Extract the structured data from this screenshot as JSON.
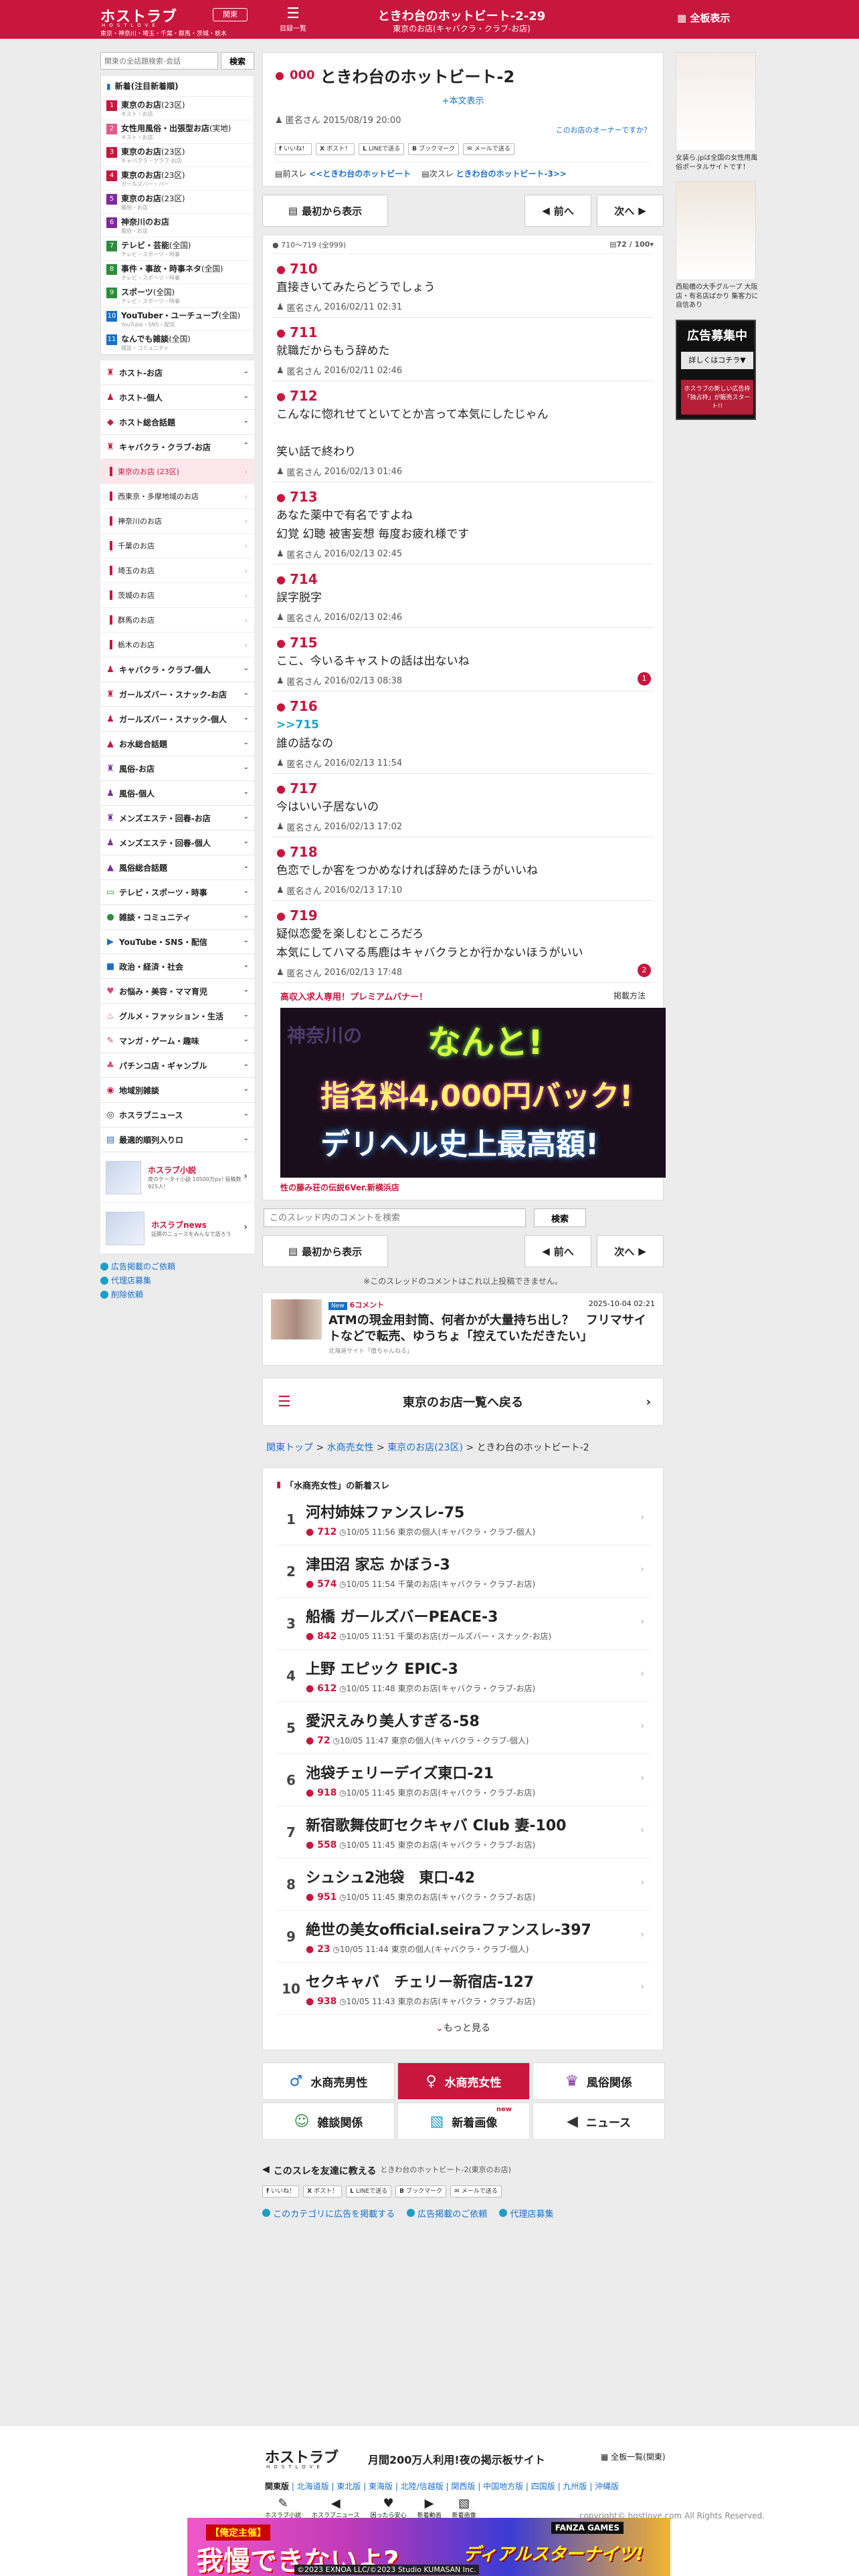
{
  "header": {
    "logo": "ホストラブ",
    "logo_sub": "HOSTLOVE",
    "region": "東京・神奈川・埼玉・千葉・群馬・茨城・栃木",
    "area_button": "関東",
    "menu_label": "目録一覧",
    "title": "ときわ台のホットビート-2-29",
    "subtitle": "東京のお店(キャバクラ・クラブ-お店)",
    "full_label": "全板表示"
  },
  "sidebar": {
    "search_placeholder": "関東の全話題検索-会話",
    "search_button": "検索",
    "box_title": "新着(注目新着順)",
    "subs": [
      {
        "num": "1",
        "title": "東京のお店",
        "count": "(23区)",
        "desc": "キスト・お店",
        "color": "#c8163d"
      },
      {
        "num": "2",
        "title": "女性用風俗・出張型お店",
        "count": "(実地)",
        "desc": "キスト・お店",
        "color": "#e05a8a"
      },
      {
        "num": "3",
        "title": "東京のお店",
        "count": "(23区)",
        "desc": "キャバクラ・クラブ-お店",
        "color": "#c8163d"
      },
      {
        "num": "4",
        "title": "東京のお店",
        "count": "(23区)",
        "desc": "ガールズバー・バー",
        "color": "#c8163d"
      },
      {
        "num": "5",
        "title": "東京のお店",
        "count": "(23区)",
        "desc": "風俗・お店",
        "color": "#7d2a9c"
      },
      {
        "num": "6",
        "title": "神奈川のお店",
        "count": "",
        "desc": "風俗・お店",
        "color": "#7d2a9c"
      },
      {
        "num": "7",
        "title": "テレビ・芸能",
        "count": "(全国)",
        "desc": "テレビ・スポーツ・時事",
        "color": "#2c8c3c"
      },
      {
        "num": "8",
        "title": "事件・事故・時事ネタ",
        "count": "(全国)",
        "desc": "テレビ・スポーツ・時事",
        "color": "#2c8c3c"
      },
      {
        "num": "9",
        "title": "スポーツ",
        "count": "(全国)",
        "desc": "テレビ・スポーツ・時事",
        "color": "#2c8c3c"
      },
      {
        "num": "10",
        "title": "YouTuber・ユーチューブ",
        "count": "(全国)",
        "desc": "YouTube・SNS・配信",
        "color": "#1a6fc9"
      },
      {
        "num": "11",
        "title": "なんでも雑談",
        "count": "(全国)",
        "desc": "雑談・コミュニティ",
        "color": "#1a6fc9"
      }
    ],
    "cats_top": [
      {
        "icon": "♜",
        "label": "ホスト-お店",
        "color": "#c8163d"
      },
      {
        "icon": "♟",
        "label": "ホスト-個人",
        "color": "#c8163d"
      },
      {
        "icon": "◆",
        "label": "ホスト総合話題",
        "color": "#c8163d"
      },
      {
        "icon": "♜",
        "label": "キャバクラ・クラブ-お店",
        "color": "#c8163d"
      }
    ],
    "sub_items": [
      "東京のお店 (23区)",
      "西東京・多摩地域のお店",
      "神奈川のお店",
      "千葉のお店",
      "埼玉のお店",
      "茨城のお店",
      "群馬のお店",
      "栃木のお店"
    ],
    "cats_bottom": [
      {
        "icon": "♟",
        "label": "キャバクラ・クラブ-個人",
        "color": "#c8163d"
      },
      {
        "icon": "♜",
        "label": "ガールズバー・スナック-お店",
        "color": "#c8163d"
      },
      {
        "icon": "♟",
        "label": "ガールズバー・スナック-個人",
        "color": "#c8163d"
      },
      {
        "icon": "▲",
        "label": "お水総合話題",
        "color": "#c8163d"
      },
      {
        "icon": "♜",
        "label": "風俗-お店",
        "color": "#7d2a9c"
      },
      {
        "icon": "♟",
        "label": "風俗-個人",
        "color": "#7d2a9c"
      },
      {
        "icon": "♜",
        "label": "メンズエステ・回春-お店",
        "color": "#7d2a9c"
      },
      {
        "icon": "♟",
        "label": "メンズエステ・回春-個人",
        "color": "#7d2a9c"
      },
      {
        "icon": "▲",
        "label": "風俗総合話題",
        "color": "#7d2a9c"
      },
      {
        "icon": "▭",
        "label": "テレビ・スポーツ・時事",
        "color": "#2c8c3c"
      },
      {
        "icon": "●",
        "label": "雑談・コミュニティ",
        "color": "#2c8c3c"
      },
      {
        "icon": "▶",
        "label": "YouTube・SNS・配信",
        "color": "#1a6fc9"
      },
      {
        "icon": "■",
        "label": "政治・経済・社会",
        "color": "#1a6fc9"
      },
      {
        "icon": "♥",
        "label": "お悩み・美容・ママ育児",
        "color": "#d04a7e"
      },
      {
        "icon": "♨",
        "label": "グルメ・ファッション・生活",
        "color": "#d04a7e"
      },
      {
        "icon": "✎",
        "label": "マンガ・ゲーム・趣味",
        "color": "#d04a7e"
      },
      {
        "icon": "♣",
        "label": "パチンコ店・ギャンブル",
        "color": "#d04a7e"
      },
      {
        "icon": "◉",
        "label": "地域別雑談",
        "color": "#c8163d"
      },
      {
        "icon": "◎",
        "label": "ホスラブニュース",
        "color": "#333333"
      },
      {
        "icon": "▤",
        "label": "最適的順列入りロ",
        "color": "#1a6fc9"
      }
    ],
    "promos": [
      {
        "title": "ホスラブ小説",
        "desc": "夜のケータイ小説 10500万pv! 投稿数925人!"
      },
      {
        "title": "ホスラブnews",
        "desc": "話題のニュースをみんなで語ろう"
      }
    ],
    "foot_links": [
      "広告掲載のご依頼",
      "代理店募集",
      "削除依頼"
    ]
  },
  "right_ads": {
    "ad1_caption": "女装ら.jpは全国の女性用風俗ポータルサイトです！",
    "ad2_caption": "西船橋の大手グループ 大阪店・有名店ばかり 集客力に自信あり",
    "recruit_top": "広告募集中",
    "recruit_mid": "詳しくはコチラ▼",
    "recruit_bottom": "ホスラブの新しい広告枠「独占枠」が販売スタート!!"
  },
  "thread": {
    "id": "000",
    "title": "ときわ台のホットビート-2",
    "show_body": "本文表示",
    "author": "匿名さん",
    "date": "2015/08/19 20:00",
    "owner_link": "このお店のオーナーですか？",
    "share": [
      "いいね！",
      "ポスト！",
      "LINEで送る",
      "ブックマーク",
      "メールで送る"
    ],
    "prev_label": "前スレ",
    "prev_link": "<<ときわ台のホットビート",
    "next_label": "次スレ",
    "next_link": "ときわ台のホットビート-3>>",
    "first_label": "最初から表示",
    "prev_btn": "前へ",
    "next_btn": "次へ",
    "range": "710〜719 (全999)",
    "page": "72 / 100"
  },
  "posts": [
    {
      "n": "710",
      "anchor": "",
      "body": "直接きいてみたらどうでしょう",
      "date": "2016/02/11 02:31",
      "badge": ""
    },
    {
      "n": "711",
      "anchor": "",
      "body": "就職だからもう辞めた",
      "date": "2016/02/11 02:46",
      "badge": ""
    },
    {
      "n": "712",
      "anchor": "",
      "body": "こんなに惚れせてといてとか言って本気にしたじゃん\n\n笑い話で終わり",
      "date": "2016/02/13 01:46",
      "badge": ""
    },
    {
      "n": "713",
      "anchor": "",
      "body": "あなた薬中で有名ですよね\n幻覚 幻聴 被害妄想 毎度お疲れ様です",
      "date": "2016/02/13 02:45",
      "badge": ""
    },
    {
      "n": "714",
      "anchor": "",
      "body": "誤字脱字",
      "date": "2016/02/13 02:46",
      "badge": ""
    },
    {
      "n": "715",
      "anchor": "",
      "body": "ここ、今いるキャストの話は出ないね",
      "date": "2016/02/13 08:38",
      "badge": "1"
    },
    {
      "n": "716",
      "anchor": ">>715",
      "body": "誰の話なの",
      "date": "2016/02/13 11:54",
      "badge": ""
    },
    {
      "n": "717",
      "anchor": "",
      "body": "今はいい子居ないの",
      "date": "2016/02/13 17:02",
      "badge": ""
    },
    {
      "n": "718",
      "anchor": "",
      "body": "色恋でしか客をつかめなければ辞めたほうがいいね",
      "date": "2016/02/13 17:10",
      "badge": ""
    },
    {
      "n": "719",
      "anchor": "",
      "body": "疑似恋愛を楽しむところだろ\n本気にしてハマる馬鹿はキャバクラとか行かないほうがいい",
      "date": "2016/02/13 17:48",
      "badge": "2"
    }
  ],
  "post_author": "匿名さん",
  "banner": {
    "head": "高収入求人専用！プレミアムバナー！",
    "right": "掲載方法",
    "line1": "なんと!",
    "line1b": "神奈川の",
    "line2": "指名料4,000円バック!",
    "line3": "デリヘル史上最高額!",
    "caption": "性の藤み荘の伝説6Ver.新横浜店"
  },
  "thread_search": {
    "placeholder": "このスレッド内のコメントを検索",
    "button": "検索"
  },
  "limit_note": "※このスレッドのコメントはこれ以上投稿できません。",
  "news": {
    "new_label": "New",
    "comments": "6コメント",
    "date": "2025-10-04 02:21",
    "title": "ATMの現金用封筒、何者かが大量持ち出し？　フリマサイトなどで転売、ゆうちょ「控えていただきたい」",
    "source": "北海道サイト「億ちゃんねる」"
  },
  "back_label": "東京のお店一覧へ戻る",
  "breadcrumb": [
    "関東トップ",
    "水商売女性",
    "東京のお店(23区)",
    "ときわ台のホットビート-2"
  ],
  "new_threads": {
    "head": "「水商売女性」の新着スレ",
    "items": [
      {
        "n": "1",
        "title": "河村姉妹ファンスレ-75",
        "count": "712",
        "date": "10/05 11:56",
        "cat": "東京の個人",
        "sub": "(キャバクラ・クラブ-個人)"
      },
      {
        "n": "2",
        "title": "津田沼 家忘 かぼう-3",
        "count": "574",
        "date": "10/05 11:54",
        "cat": "千葉のお店",
        "sub": "(キャバクラ・クラブ-お店)"
      },
      {
        "n": "3",
        "title": "船橋 ガールズバーPEACE-3",
        "count": "842",
        "date": "10/05 11:51",
        "cat": "千葉のお店",
        "sub": "(ガールズバー・スナック-お店)"
      },
      {
        "n": "4",
        "title": "上野 エピック EPIC-3",
        "count": "612",
        "date": "10/05 11:48",
        "cat": "東京のお店",
        "sub": "(キャバクラ・クラブ-お店)"
      },
      {
        "n": "5",
        "title": "愛沢えみり美人すぎる-58",
        "count": "72",
        "date": "10/05 11:47",
        "cat": "東京の個人",
        "sub": "(キャバクラ・クラブ-個人)"
      },
      {
        "n": "6",
        "title": "池袋チェリーデイズ東口-21",
        "count": "918",
        "date": "10/05 11:45",
        "cat": "東京のお店",
        "sub": "(キャバクラ・クラブ-お店)"
      },
      {
        "n": "7",
        "title": "新宿歌舞伎町セクキャバ Club 妻-100",
        "count": "558",
        "date": "10/05 11:45",
        "cat": "東京のお店",
        "sub": "(キャバクラ・クラブ-お店)"
      },
      {
        "n": "8",
        "title": "シュシュ2池袋　東口-42",
        "count": "951",
        "date": "10/05 11:45",
        "cat": "東京のお店",
        "sub": "(キャバクラ・クラブ-お店)"
      },
      {
        "n": "9",
        "title": "絶世の美女official.seiraファンスレ-397",
        "count": "23",
        "date": "10/05 11:44",
        "cat": "東京の個人",
        "sub": "(キャバクラ・クラブ-個人)"
      },
      {
        "n": "10",
        "title": "セクキャバ　チェリー新宿店-127",
        "count": "938",
        "date": "10/05 11:43",
        "cat": "東京のお店",
        "sub": "(キャバクラ・クラブ-お店)"
      }
    ],
    "more": "もっと見る"
  },
  "bottom_nav": [
    {
      "icon": "♂",
      "label": "水商売男性",
      "color": "#1a6fc9"
    },
    {
      "icon": "♀",
      "label": "水商売女性",
      "color": "#ffffff"
    },
    {
      "icon": "♛",
      "label": "風俗関係",
      "color": "#7d2a9c"
    },
    {
      "icon": "☺",
      "label": "雑談関係",
      "color": "#2c8c3c"
    },
    {
      "icon": "▧",
      "label": "新着画像",
      "color": "#1aa0c8"
    },
    {
      "icon": "◀",
      "label": "ニュース",
      "color": "#333333"
    }
  ],
  "new_badge": "new",
  "share_thread": {
    "head": "このスレを友達に教える",
    "head_sub": "ときわ台のホットビート-2(東京のお店)",
    "links": [
      "このカテゴリに広告を掲載する",
      "広告掲載のご依頼",
      "代理店募集"
    ]
  },
  "footer": {
    "logo": "ホストラブ",
    "logo_sub": "HOSTLOVE",
    "tagline": "月間200万人利用!夜の掲示板サイト",
    "map": "全板一覧(関東)",
    "areas_head": "関東版",
    "areas": "北海道版 | 東北版 | 東海版 | 北陸/信越版 | 関西版 | 中国地方版 | 四国版 | 九州版 | 沖縄版",
    "icons": [
      "ホスラブ小説",
      "ホスラブニュース",
      "困ったら安心",
      "新着動画",
      "新着画像"
    ],
    "copyright": "copyright© hostlove.com All Rights Reserved.",
    "ban_a": "【俺定主催】",
    "ban_b": "我慢できないよ?",
    "ban_c": "©2023 EXNOA LLC/©2023 Studio KUMASAN Inc.",
    "ban_d": "ディアルスターナイツ!",
    "ban_e": "FANZA GAMES"
  }
}
